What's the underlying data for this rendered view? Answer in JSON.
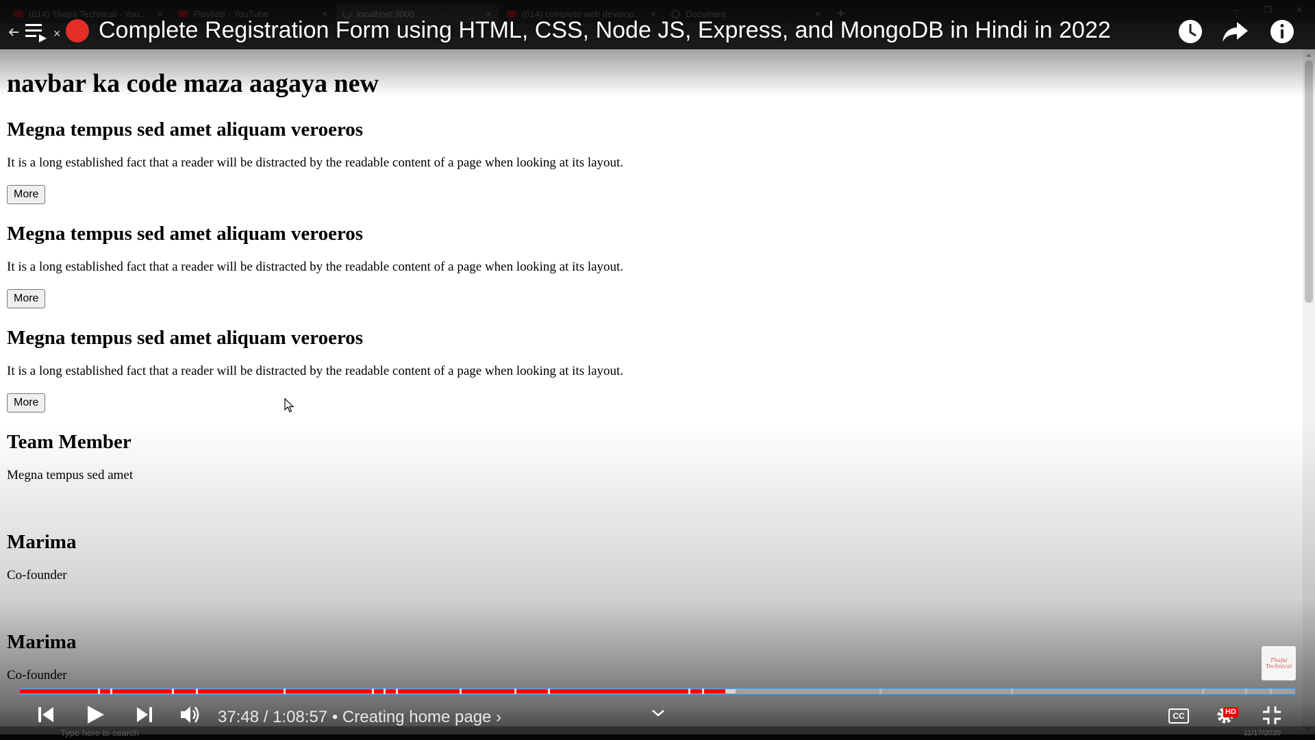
{
  "browser": {
    "tabs": [
      {
        "label": "(614) Thapa Technical - YouTube",
        "icon": "youtube-icon",
        "active": false
      },
      {
        "label": "Playlists - YouTube",
        "icon": "youtube-icon",
        "active": false
      },
      {
        "label": "localhost:3000",
        "icon": "loading-spinner-icon",
        "active": true
      },
      {
        "label": "(614) complete web developmen",
        "icon": "youtube-icon",
        "active": false
      },
      {
        "label": "Document",
        "icon": "globe-icon",
        "active": false
      }
    ],
    "new_tab_symbol": "+"
  },
  "video": {
    "title": "Complete Registration Form using HTML, CSS, Node JS, Express, and MongoDB in Hindi in 2022",
    "current_time": "37:48",
    "duration": "1:08:57",
    "chapter": "Creating home page",
    "chapter_arrow": "›",
    "time_separator": "/",
    "bullet": "•",
    "played_fraction": 0.553,
    "loaded_fraction": 0.561,
    "chapter_marks": [
      0.061,
      0.071,
      0.119,
      0.138,
      0.207,
      0.276,
      0.285,
      0.295,
      0.345,
      0.388,
      0.414,
      0.524,
      0.535,
      0.674,
      0.777,
      0.927,
      0.961,
      0.98
    ],
    "accent_color": "#ff0000",
    "watermark_text": "Thapa Technical",
    "hd_badge": "HD",
    "cc_label": "CC"
  },
  "page": {
    "heading": "navbar ka code maza aagaya new",
    "sections": [
      {
        "title": "Megna tempus sed amet aliquam veroeros",
        "text": "It is a long established fact that a reader will be distracted by the readable content of a page when looking at its layout.",
        "button": "More"
      },
      {
        "title": "Megna tempus sed amet aliquam veroeros",
        "text": "It is a long established fact that a reader will be distracted by the readable content of a page when looking at its layout.",
        "button": "More"
      },
      {
        "title": "Megna tempus sed amet aliquam veroeros",
        "text": "It is a long established fact that a reader will be distracted by the readable content of a page when looking at its layout.",
        "button": "More"
      }
    ],
    "team_heading": "Team Member",
    "team_text": "Megna tempus sed amet",
    "members": [
      {
        "name": "Marima",
        "role": "Co-founder"
      },
      {
        "name": "Marima",
        "role": "Co-founder"
      }
    ]
  },
  "taskbar": {
    "search_placeholder": "Type here to search",
    "date": "11/17/2020"
  }
}
